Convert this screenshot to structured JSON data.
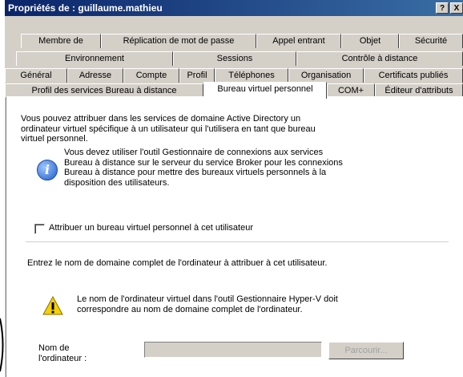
{
  "window": {
    "title": "Propriétés de : guillaume.mathieu",
    "help_button": "?",
    "close_button": "X"
  },
  "tabs": {
    "row1": [
      "Membre de",
      "Réplication de mot de passe",
      "Appel entrant",
      "Objet",
      "Sécurité"
    ],
    "row2": [
      "Environnement",
      "Sessions",
      "Contrôle à distance"
    ],
    "row3": [
      "Général",
      "Adresse",
      "Compte",
      "Profil",
      "Téléphones",
      "Organisation",
      "Certificats publiés"
    ],
    "row4": [
      "Profil des services Bureau à distance",
      "Bureau virtuel personnel",
      "COM+",
      "Éditeur d'attributs"
    ]
  },
  "content": {
    "intro": [
      "Vous pouvez attribuer dans les services de domaine Active Directory un",
      "ordinateur virtuel spécifique à un utilisateur qui l'utilisera en tant que bureau",
      "virtuel personnel."
    ],
    "info_text": [
      "Vous devez utiliser l'outil Gestionnaire de connexions aux services",
      "Bureau à distance sur le serveur du service Broker pour les connexions",
      "Bureau à distance pour mettre des bureaux virtuels personnels à la",
      "disposition des utilisateurs."
    ],
    "checkbox_label": "Attribuer un bureau virtuel personnel à cet utilisateur",
    "fqdn_prompt": "Entrez le nom de domaine complet de l'ordinateur à attribuer à cet utilisateur.",
    "warning_text": [
      "Le nom de l'ordinateur virtuel dans l'outil Gestionnaire Hyper-V doit",
      "correspondre au nom de domaine complet de l'ordinateur."
    ],
    "computer_name_label": [
      "Nom de",
      "l'ordinateur :"
    ],
    "computer_name_value": "",
    "browse_button": "Parcourir..."
  }
}
